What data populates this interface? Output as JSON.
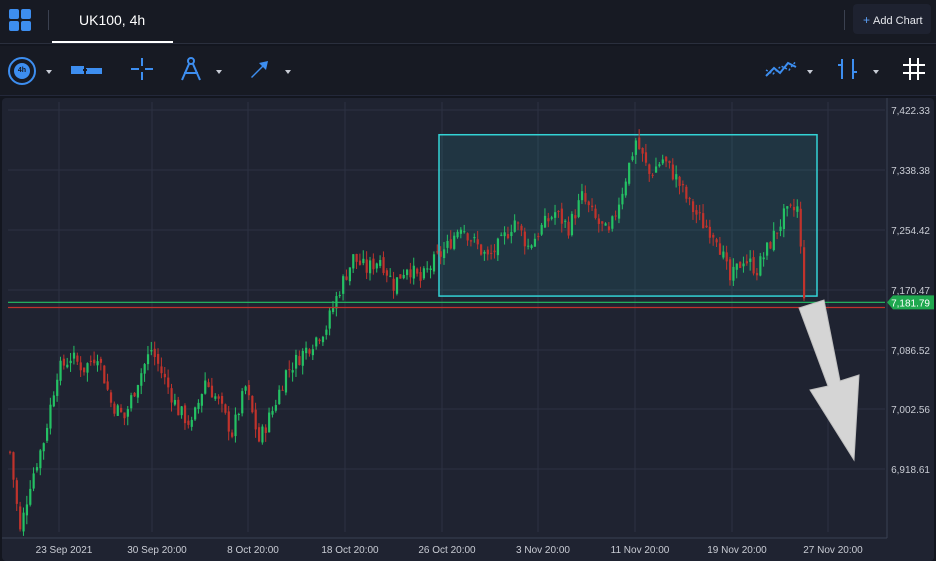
{
  "tab": {
    "label": "UK100, 4h"
  },
  "add_chart": {
    "label": "Add Chart"
  },
  "toolbar": {
    "timeframe": "4h",
    "icons": [
      "timeframe-icon",
      "chart-type-icon",
      "crosshair-icon",
      "drawing-tools-icon",
      "arrow-tool-icon",
      "indicators-icon",
      "studies-icon",
      "grid-icon"
    ]
  },
  "colors": {
    "up": "#24c164",
    "down": "#c0332c",
    "box_border": "#33d3d6",
    "price_tag": "#1fa84f",
    "arrow": "#d5d5d5"
  },
  "chart_data": {
    "type": "candlestick",
    "symbol": "UK100",
    "interval": "4h",
    "y_ticks": [
      "7,422.33",
      "7,338.38",
      "7,254.42",
      "7,170.47",
      "7,086.52",
      "7,002.56",
      "6,918.61"
    ],
    "x_ticks": [
      "23 Sep 2021",
      "30 Sep 20:00",
      "8 Oct 20:00",
      "18 Oct 20:00",
      "26 Oct 20:00",
      "3 Nov 20:00",
      "11 Nov 20:00",
      "19 Nov 20:00",
      "27 Nov 20:00"
    ],
    "last_price_label": "7,181.79",
    "ylim": [
      6880,
      7445
    ],
    "horizontal_levels": [
      7181.79,
      7175
    ],
    "range_box": {
      "price_top": 7402,
      "price_bottom": 7190
    },
    "close_path": [
      [
        0,
        6985
      ],
      [
        3,
        6880
      ],
      [
        6,
        6945
      ],
      [
        10,
        7000
      ],
      [
        14,
        7090
      ],
      [
        18,
        7110
      ],
      [
        22,
        7095
      ],
      [
        26,
        7115
      ],
      [
        30,
        7050
      ],
      [
        34,
        7030
      ],
      [
        38,
        7080
      ],
      [
        42,
        7120
      ],
      [
        46,
        7080
      ],
      [
        50,
        7040
      ],
      [
        54,
        7020
      ],
      [
        58,
        7080
      ],
      [
        62,
        7050
      ],
      [
        66,
        7010
      ],
      [
        70,
        7070
      ],
      [
        74,
        7000
      ],
      [
        78,
        7040
      ],
      [
        82,
        7090
      ],
      [
        86,
        7110
      ],
      [
        90,
        7130
      ],
      [
        94,
        7150
      ],
      [
        98,
        7200
      ],
      [
        102,
        7240
      ],
      [
        106,
        7225
      ],
      [
        110,
        7240
      ],
      [
        114,
        7205
      ],
      [
        118,
        7230
      ],
      [
        122,
        7210
      ],
      [
        126,
        7235
      ],
      [
        130,
        7255
      ],
      [
        134,
        7285
      ],
      [
        138,
        7260
      ],
      [
        142,
        7240
      ],
      [
        146,
        7260
      ],
      [
        150,
        7290
      ],
      [
        154,
        7255
      ],
      [
        158,
        7280
      ],
      [
        162,
        7300
      ],
      [
        166,
        7280
      ],
      [
        170,
        7320
      ],
      [
        174,
        7290
      ],
      [
        178,
        7270
      ],
      [
        182,
        7330
      ],
      [
        186,
        7395
      ],
      [
        190,
        7350
      ],
      [
        194,
        7370
      ],
      [
        198,
        7345
      ],
      [
        202,
        7310
      ],
      [
        206,
        7285
      ],
      [
        210,
        7270
      ],
      [
        214,
        7210
      ],
      [
        218,
        7240
      ],
      [
        222,
        7225
      ],
      [
        226,
        7260
      ],
      [
        230,
        7295
      ],
      [
        234,
        7305
      ],
      [
        236,
        7195
      ]
    ]
  }
}
